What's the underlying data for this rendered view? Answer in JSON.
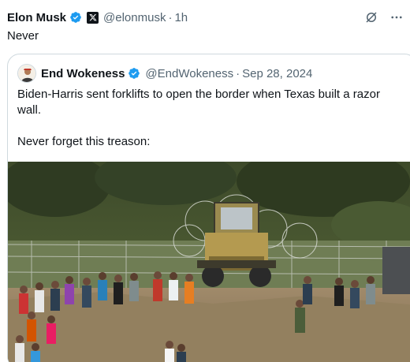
{
  "tweet": {
    "author_name": "Elon Musk",
    "handle": "@elonmusk",
    "separator": "·",
    "time": "1h",
    "text": "Never"
  },
  "quoted": {
    "author_name": "End Wokeness",
    "handle": "@EndWokeness",
    "separator": "·",
    "date": "Sep 28, 2024",
    "text": "Biden-Harris sent forklifts to open the border when Texas built a razor wall.\n\nNever forget this treason:"
  },
  "icons": {
    "verified": "verified-badge-icon",
    "affiliate": "x-logo-icon",
    "grok": "grok-icon",
    "more": "more-icon"
  },
  "colors": {
    "verified_blue": "#1d9bf0",
    "secondary_text": "#536471",
    "border": "#cfd9de"
  }
}
